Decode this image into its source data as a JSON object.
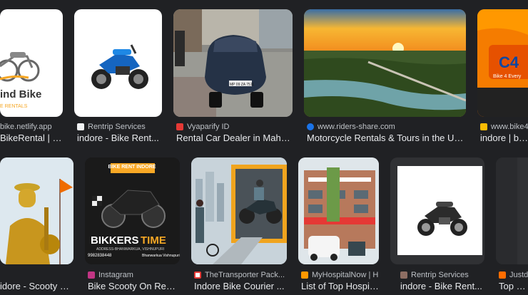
{
  "results": [
    {
      "source": "bike.netlify.app",
      "title": "BikeRental | B...",
      "logo_text": "ind Bike",
      "logo_sub": "E RENTALS"
    },
    {
      "source": "Rentrip Services",
      "title": "indore - Bike Rent..."
    },
    {
      "source": "Vyaparify ID",
      "title": "Rental Car Dealer in Mahal...",
      "plate": "MP 09 ZA 7511"
    },
    {
      "source": "www.riders-share.com",
      "title": "Motorcycle Rentals & Tours in the US..."
    },
    {
      "source": "www.bike4e",
      "title": "indore | bike",
      "logo_text": "C4",
      "logo_sub": "Bike 4 Every"
    },
    {
      "source": "",
      "title": "idore - Scooty on..."
    },
    {
      "source": "Instagram",
      "title": "Bike Scooty On Rent...",
      "poster_top": "BIKE RENT INDORE",
      "poster_brand": "BIKKERS",
      "poster_brand2": "TIME",
      "poster_addr": "ADDRESS-BHANWARKUA, VISHNUPURI",
      "poster_phone": "9982838448",
      "poster_loc": "Bhanwarkua Vishnupuri"
    },
    {
      "source": "TheTransporter Pack...",
      "title": "Indore Bike Courier ..."
    },
    {
      "source": "MyHospitalNow | H...",
      "title": "List of Top Hospital..."
    },
    {
      "source": "Rentrip Services",
      "title": "indore - Bike Rent..."
    },
    {
      "source": "Justdi",
      "title": "Top Mot"
    }
  ],
  "favicon_colors": [
    "#ffffff",
    "#f1f3f4",
    "#e53935",
    "#1a73e8",
    "#fbbc04",
    "#ffffff",
    "#c13584",
    "#ffffff",
    "#ff9800",
    "#8d6e63",
    "#ff6d00"
  ]
}
